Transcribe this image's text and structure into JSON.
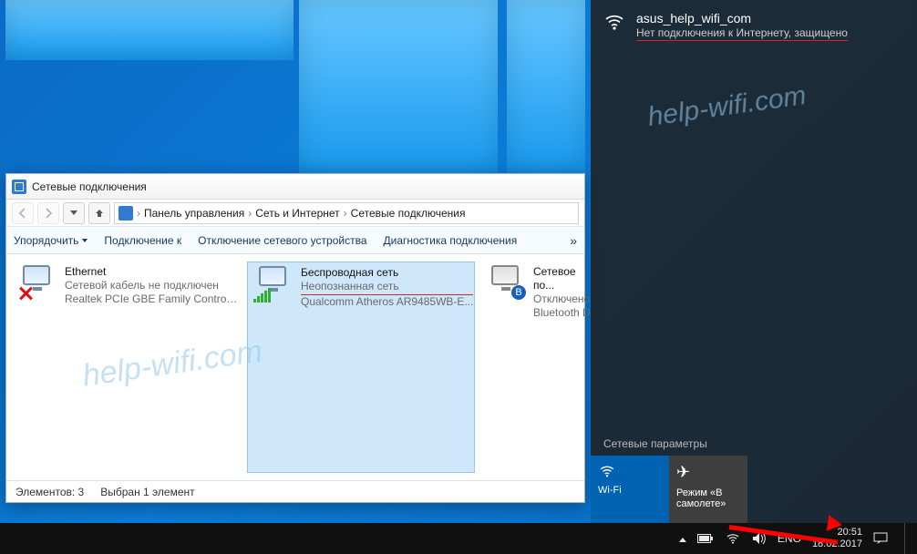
{
  "explorer": {
    "title": "Сетевые подключения",
    "breadcrumb": {
      "seg1": "Панель управления",
      "seg2": "Сеть и Интернет",
      "seg3": "Сетевые подключения"
    },
    "toolbar": {
      "organize": "Упорядочить",
      "connect_to": "Подключение к",
      "disable_device": "Отключение сетевого устройства",
      "diagnose": "Диагностика подключения"
    },
    "connections": [
      {
        "name": "Ethernet",
        "status": "Сетевой кабель не подключен",
        "device": "Realtek PCIe GBE Family Controller"
      },
      {
        "name": "Беспроводная сеть",
        "status": "Неопознанная сеть",
        "device": "Qualcomm Atheros AR9485WB-E..."
      },
      {
        "name": "Сетевое по...",
        "status": "Отключено",
        "device": "Bluetooth D..."
      }
    ],
    "statusbar": {
      "count_label": "Элементов: 3",
      "selection_label": "Выбран 1 элемент"
    }
  },
  "flyout": {
    "network_name": "asus_help_wifi_com",
    "network_status": "Нет подключения к Интернету, защищено",
    "settings_label": "Сетевые параметры",
    "tile_wifi": "Wi-Fi",
    "tile_airplane": "Режим «В самолете»"
  },
  "taskbar": {
    "lang": "ENG",
    "time": "20:51",
    "date": "18.02.2017"
  },
  "watermark": "help-wifi.com"
}
